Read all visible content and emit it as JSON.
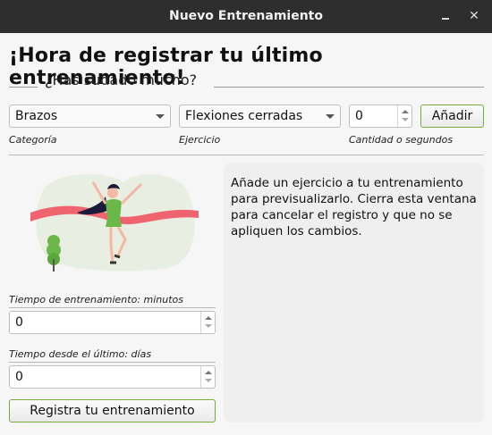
{
  "window": {
    "title": "Nuevo Entrenamiento",
    "minimize_glyph": "",
    "close_glyph": "✕"
  },
  "header": {
    "title": "¡Hora de registrar tu último entrenamiento!",
    "subtitle": "¿Has sudado mucho?"
  },
  "form": {
    "category": {
      "value": "Brazos",
      "caption": "Categoría"
    },
    "exercise": {
      "value": "Flexiones cerradas",
      "caption": "Ejercicio"
    },
    "quantity": {
      "value": "0",
      "caption": "Cantidad o segundos"
    },
    "add_label": "Añadir"
  },
  "training": {
    "minutes_label": "Tiempo de entrenamiento: minutos",
    "minutes_value": "0",
    "days_label": "Tiempo desde el último: días",
    "days_value": "0",
    "register_label": "Registra tu entrenamiento"
  },
  "preview": {
    "text": "Añade un ejercicio a tu entrenamiento para previsualizarlo. Cierra esta ventana para cancelar el registro y que no se apliquen los cambios."
  },
  "icons": {
    "illustration": "runner-finish-line-illustration",
    "tree": "tree-icon"
  },
  "colors": {
    "accent_border": "#7aab3a",
    "ribbon": "#f06470",
    "titlebar": "#2e2e2e"
  }
}
